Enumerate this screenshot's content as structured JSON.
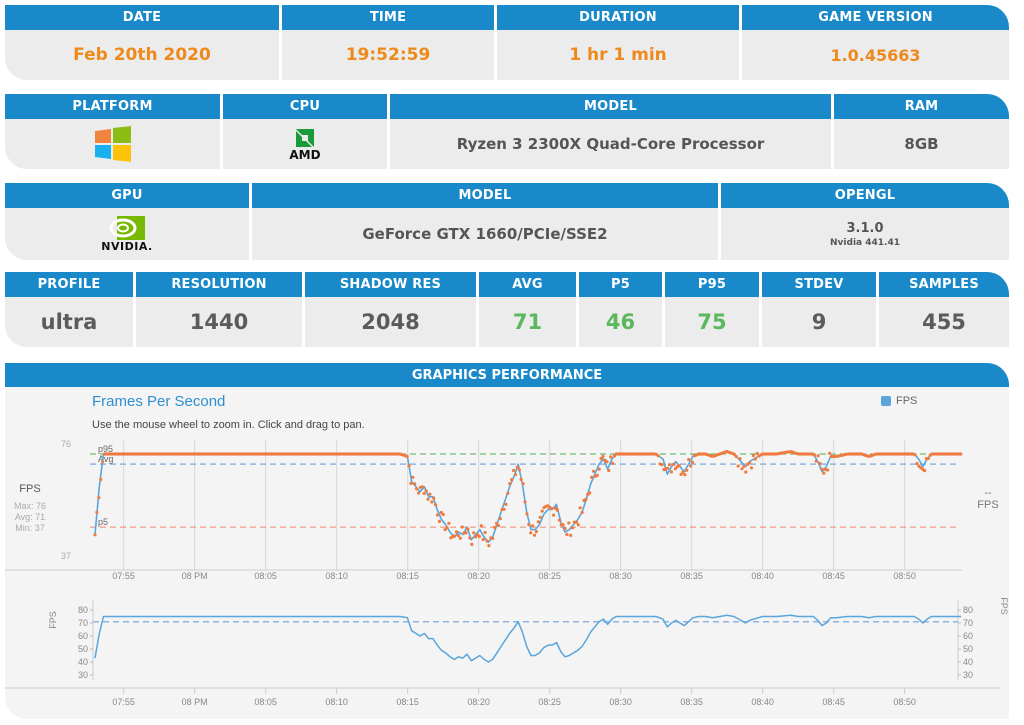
{
  "session": {
    "headers": [
      "DATE",
      "TIME",
      "DURATION",
      "GAME VERSION"
    ],
    "date": "Feb 20th 2020",
    "time": "19:52:59",
    "duration": "1 hr 1 min",
    "game_version": "1.0.45663"
  },
  "cpu_info": {
    "headers": [
      "PLATFORM",
      "CPU",
      "MODEL",
      "RAM"
    ],
    "platform_icon": "windows-logo",
    "cpu_icon": "amd-logo",
    "cpu_brand": "AMD",
    "model": "Ryzen 3 2300X Quad-Core Processor",
    "ram": "8GB"
  },
  "gpu_info": {
    "headers": [
      "GPU",
      "MODEL",
      "OPENGL"
    ],
    "gpu_icon": "nvidia-logo",
    "gpu_brand": "NVIDIA.",
    "model": "GeForce GTX 1660/PCIe/SSE2",
    "opengl_version": "3.1.0",
    "driver": "Nvidia 441.41"
  },
  "stats": {
    "headers": [
      "PROFILE",
      "RESOLUTION",
      "SHADOW RES",
      "AVG",
      "P5",
      "P95",
      "STDEV",
      "SAMPLES"
    ],
    "profile": "ultra",
    "resolution": "1440",
    "shadow_res": "2048",
    "avg": "71",
    "p5": "46",
    "p95": "75",
    "stdev": "9",
    "samples": "455"
  },
  "performance": {
    "section_title": "GRAPHICS PERFORMANCE",
    "chart_title": "Frames Per Second",
    "hint": "Use the mouse wheel to zoom in. Click and drag to pan.",
    "legend_label": "FPS",
    "side_label": "FPS",
    "side_max": "Max: 76",
    "side_avg": "Avg: 71",
    "side_min": "Min: 37",
    "right_value": "--",
    "right_label": "FPS",
    "nav_axis_label": "FPS"
  },
  "colors": {
    "header_blue": "#1a89c9",
    "series_line": "#5aa5dc",
    "points": "#f07a3f",
    "p95_line": "#4caf50",
    "avg_line": "#8fb4e0",
    "p5_line": "#f0846a",
    "value_orange": "#ee8a1c",
    "value_green": "#5cb85c"
  },
  "chart_data": {
    "type": "line",
    "title": "Frames Per Second",
    "subtitle": "Use the mouse wheel to zoom in. Click and drag to pan.",
    "xlabel": "",
    "ylabel": "FPS",
    "x_unit": "minutes since 19:52:59",
    "x_range": [
      0,
      61
    ],
    "ylim": [
      37,
      76
    ],
    "y_ticks": [
      "76",
      "37"
    ],
    "x_ticks": [
      {
        "label": "07:55",
        "t": 2.02
      },
      {
        "label": "08 PM",
        "t": 7.02
      },
      {
        "label": "08:05",
        "t": 12.02
      },
      {
        "label": "08:10",
        "t": 17.02
      },
      {
        "label": "08:15",
        "t": 22.02
      },
      {
        "label": "08:20",
        "t": 27.02
      },
      {
        "label": "08:25",
        "t": 32.02
      },
      {
        "label": "08:30",
        "t": 37.02
      },
      {
        "label": "08:35",
        "t": 42.02
      },
      {
        "label": "08:40",
        "t": 47.02
      },
      {
        "label": "08:45",
        "t": 52.02
      },
      {
        "label": "08:50",
        "t": 57.02
      }
    ],
    "reference_lines": [
      {
        "name": "p95",
        "value": 75
      },
      {
        "name": "Avg",
        "value": 71
      },
      {
        "name": "p5",
        "value": 46
      }
    ],
    "legend": [
      "FPS"
    ],
    "legend_position": "top-right",
    "grid": true,
    "series": [
      {
        "name": "FPS",
        "points": [
          [
            0.0,
            43
          ],
          [
            0.3,
            62
          ],
          [
            0.6,
            75
          ],
          [
            1,
            75
          ],
          [
            3,
            75
          ],
          [
            6,
            75
          ],
          [
            10,
            75
          ],
          [
            14,
            75
          ],
          [
            18,
            75
          ],
          [
            21.5,
            75
          ],
          [
            22.0,
            74
          ],
          [
            22.3,
            64
          ],
          [
            22.6,
            62
          ],
          [
            22.9,
            60
          ],
          [
            23.2,
            62
          ],
          [
            23.5,
            58
          ],
          [
            23.8,
            58
          ],
          [
            24.1,
            53
          ],
          [
            24.4,
            49
          ],
          [
            24.7,
            47
          ],
          [
            25.0,
            44
          ],
          [
            25.3,
            42
          ],
          [
            25.6,
            44
          ],
          [
            25.9,
            43
          ],
          [
            26.2,
            46
          ],
          [
            26.5,
            41
          ],
          [
            26.8,
            43
          ],
          [
            27.1,
            45
          ],
          [
            27.4,
            42
          ],
          [
            27.7,
            40
          ],
          [
            28.0,
            42
          ],
          [
            28.3,
            47
          ],
          [
            28.6,
            52
          ],
          [
            28.9,
            57
          ],
          [
            29.2,
            62
          ],
          [
            29.5,
            66
          ],
          [
            29.8,
            71
          ],
          [
            30.1,
            63
          ],
          [
            30.4,
            52
          ],
          [
            30.7,
            45
          ],
          [
            31.0,
            45
          ],
          [
            31.3,
            47
          ],
          [
            31.6,
            51
          ],
          [
            31.9,
            53
          ],
          [
            32.2,
            53
          ],
          [
            32.5,
            55
          ],
          [
            32.8,
            48
          ],
          [
            33.1,
            44
          ],
          [
            33.4,
            45
          ],
          [
            33.7,
            47
          ],
          [
            34.0,
            49
          ],
          [
            34.3,
            52
          ],
          [
            34.6,
            57
          ],
          [
            34.9,
            63
          ],
          [
            35.2,
            67
          ],
          [
            35.5,
            71
          ],
          [
            35.8,
            73
          ],
          [
            36.1,
            69
          ],
          [
            36.4,
            73
          ],
          [
            36.7,
            75
          ],
          [
            37,
            75
          ],
          [
            38,
            75
          ],
          [
            39.5,
            75
          ],
          [
            40.0,
            73
          ],
          [
            40.3,
            67
          ],
          [
            40.6,
            70
          ],
          [
            40.9,
            72
          ],
          [
            41.2,
            70
          ],
          [
            41.5,
            68
          ],
          [
            41.8,
            71
          ],
          [
            42.1,
            74
          ],
          [
            42.5,
            75
          ],
          [
            43,
            75
          ],
          [
            43.5,
            74
          ],
          [
            44,
            75
          ],
          [
            44.5,
            76
          ],
          [
            45.0,
            75
          ],
          [
            45.5,
            72
          ],
          [
            45.8,
            70
          ],
          [
            46.1,
            72
          ],
          [
            46.4,
            73
          ],
          [
            46.7,
            74
          ],
          [
            47,
            75
          ],
          [
            48,
            75
          ],
          [
            49.0,
            76
          ],
          [
            49.5,
            75
          ],
          [
            50.6,
            75
          ],
          [
            50.9,
            72
          ],
          [
            51.2,
            68
          ],
          [
            51.5,
            70
          ],
          [
            51.8,
            74
          ],
          [
            52.2,
            74
          ],
          [
            53,
            75
          ],
          [
            54,
            75
          ],
          [
            54.5,
            74
          ],
          [
            55,
            75
          ],
          [
            56,
            75
          ],
          [
            57.7,
            75
          ],
          [
            58.0,
            73
          ],
          [
            58.3,
            70
          ],
          [
            58.6,
            73
          ],
          [
            58.9,
            75
          ],
          [
            60,
            75
          ],
          [
            61,
            75
          ]
        ]
      }
    ],
    "navigator": {
      "ylim": [
        30,
        80
      ],
      "y_ticks": [
        30,
        40,
        50,
        60,
        70,
        80
      ],
      "ylabel": "FPS",
      "reference_line": 71
    }
  }
}
